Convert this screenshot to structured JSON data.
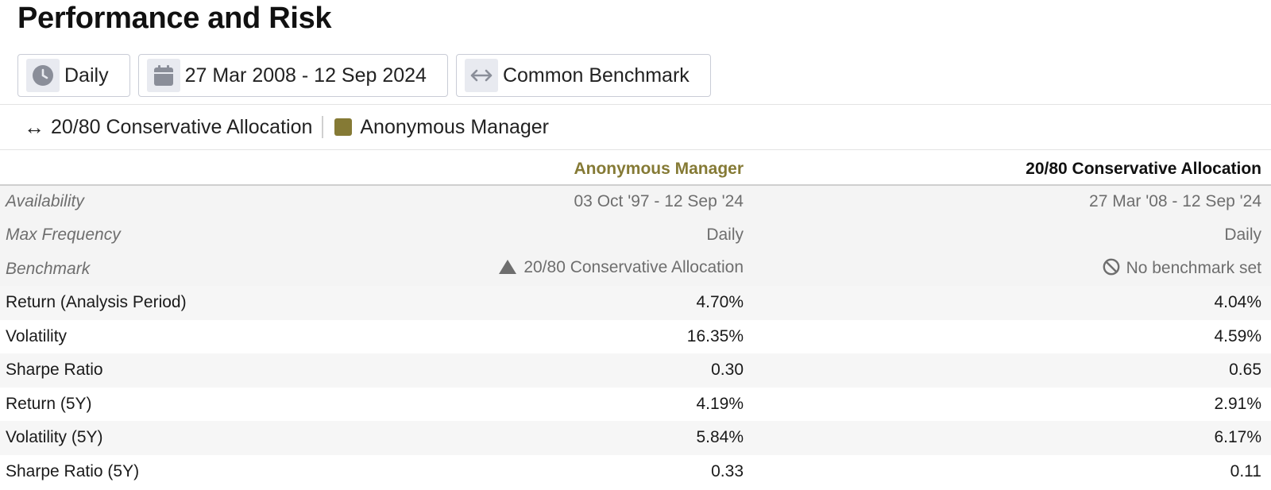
{
  "page": {
    "title": "Performance and Risk"
  },
  "toolbar": {
    "frequency": {
      "icon": "clock-icon",
      "label": "Daily"
    },
    "date_range": {
      "icon": "calendar-icon",
      "label": "27 Mar 2008 - 12 Sep 2024"
    },
    "benchmark": {
      "icon": "double-arrow-icon",
      "label": "Common Benchmark"
    }
  },
  "legend": {
    "benchmark_symbol": "↔",
    "benchmark_name": "20/80 Conservative Allocation",
    "manager_name": "Anonymous Manager",
    "manager_color": "#857a35"
  },
  "table": {
    "columns": [
      "",
      "Anonymous Manager",
      "20/80 Conservative Allocation"
    ],
    "meta_rows": [
      {
        "label": "Availability",
        "v1": "03 Oct '97 - 12 Sep '24",
        "v2": "27 Mar '08 - 12 Sep '24"
      },
      {
        "label": "Max Frequency",
        "v1": "Daily",
        "v2": "Daily"
      },
      {
        "label": "Benchmark",
        "v1": "20/80 Conservative Allocation",
        "v1_icon": "triangle-icon",
        "v2": "No benchmark set",
        "v2_icon": "no-entry-icon"
      }
    ],
    "rows": [
      {
        "label": "Return (Analysis Period)",
        "v1": "4.70%",
        "v2": "4.04%"
      },
      {
        "label": "Volatility",
        "v1": "16.35%",
        "v2": "4.59%"
      },
      {
        "label": "Sharpe Ratio",
        "v1": "0.30",
        "v2": "0.65"
      },
      {
        "label": "Return (5Y)",
        "v1": "4.19%",
        "v2": "2.91%"
      },
      {
        "label": "Volatility (5Y)",
        "v1": "5.84%",
        "v2": "6.17%"
      },
      {
        "label": "Sharpe Ratio (5Y)",
        "v1": "0.33",
        "v2": "0.11"
      }
    ]
  }
}
